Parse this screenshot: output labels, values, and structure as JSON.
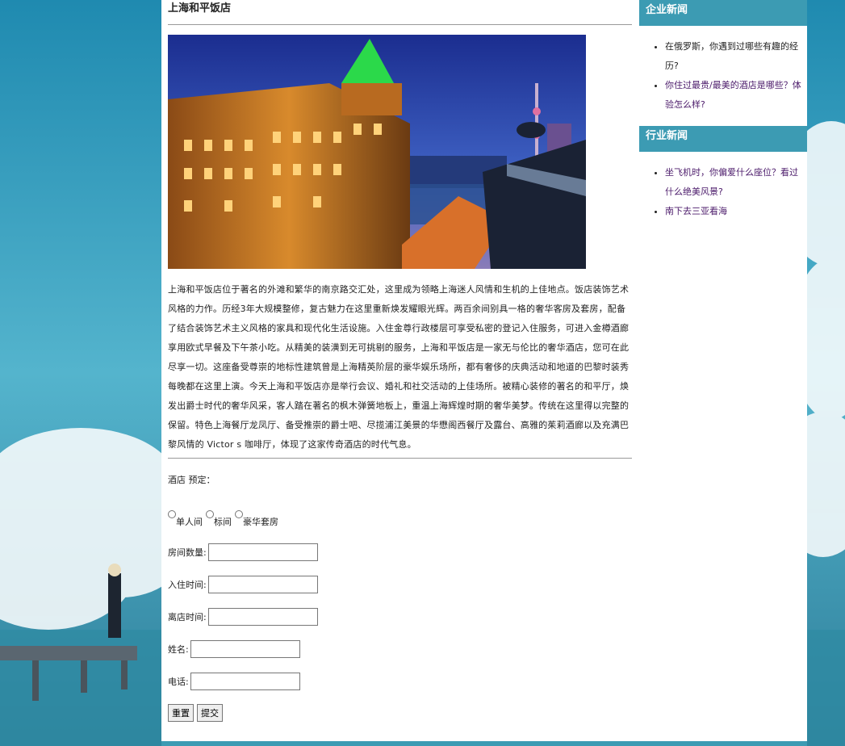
{
  "page": {
    "title": "上海和平饭店",
    "description": "上海和平饭店位于著名的外滩和繁华的南京路交汇处，这里成为领略上海迷人风情和生机的上佳地点。饭店装饰艺术风格的力作。历经3年大规模整修，复古魅力在这里重新焕发耀眼光辉。两百余间别具一格的奢华客房及套房，配备了结合装饰艺术主义风格的家具和现代化生活设施。入住金尊行政楼层可享受私密的登记入住服务，可进入金樽酒廊享用欧式早餐及下午茶小吃。从精美的装潢到无可挑剔的服务，上海和平饭店是一家无与伦比的奢华酒店，您可在此尽享一切。这座备受尊崇的地标性建筑曾是上海精英阶层的豪华娱乐场所，都有奢侈的庆典活动和地道的巴黎时装秀每晚都在这里上演。今天上海和平饭店亦是举行会议、婚礼和社交活动的上佳场所。被精心装修的著名的和平厅，焕发出爵士时代的奢华风采，客人踏在著名的枫木弹簧地板上，重温上海辉煌时期的奢华美梦。传统在这里得以完整的保留。特色上海餐厅龙凤厅、备受推崇的爵士吧、尽揽浦江美景的华懋阁西餐厅及露台、高雅的茱莉酒廊以及充满巴黎风情的 Victor s 咖啡厅，体现了这家传奇酒店的时代气息。"
  },
  "form": {
    "title": "酒店 预定：",
    "room_types": [
      "单人间",
      "标间",
      "豪华套房"
    ],
    "fields": [
      {
        "label": "房间数量:",
        "value": ""
      },
      {
        "label": "入住时间:",
        "value": ""
      },
      {
        "label": "离店时间:",
        "value": ""
      },
      {
        "label": "姓名:",
        "value": ""
      },
      {
        "label": "电话:",
        "value": ""
      }
    ],
    "reset_label": "重置",
    "submit_label": "提交"
  },
  "sidebar": {
    "company_news": {
      "title": "企业新闻",
      "items": [
        "在俄罗斯，你遇到过哪些有趣的经历?",
        "你住过最贵/最美的酒店是哪些？体验怎么样?"
      ]
    },
    "industry_news": {
      "title": "行业新闻",
      "items": [
        "坐飞机时，你偏爱什么座位？看过什么绝美风景?",
        "南下去三亚看海"
      ]
    }
  },
  "colors": {
    "accent": "#3c9bb3",
    "link_visited": "#4b1a6a"
  }
}
